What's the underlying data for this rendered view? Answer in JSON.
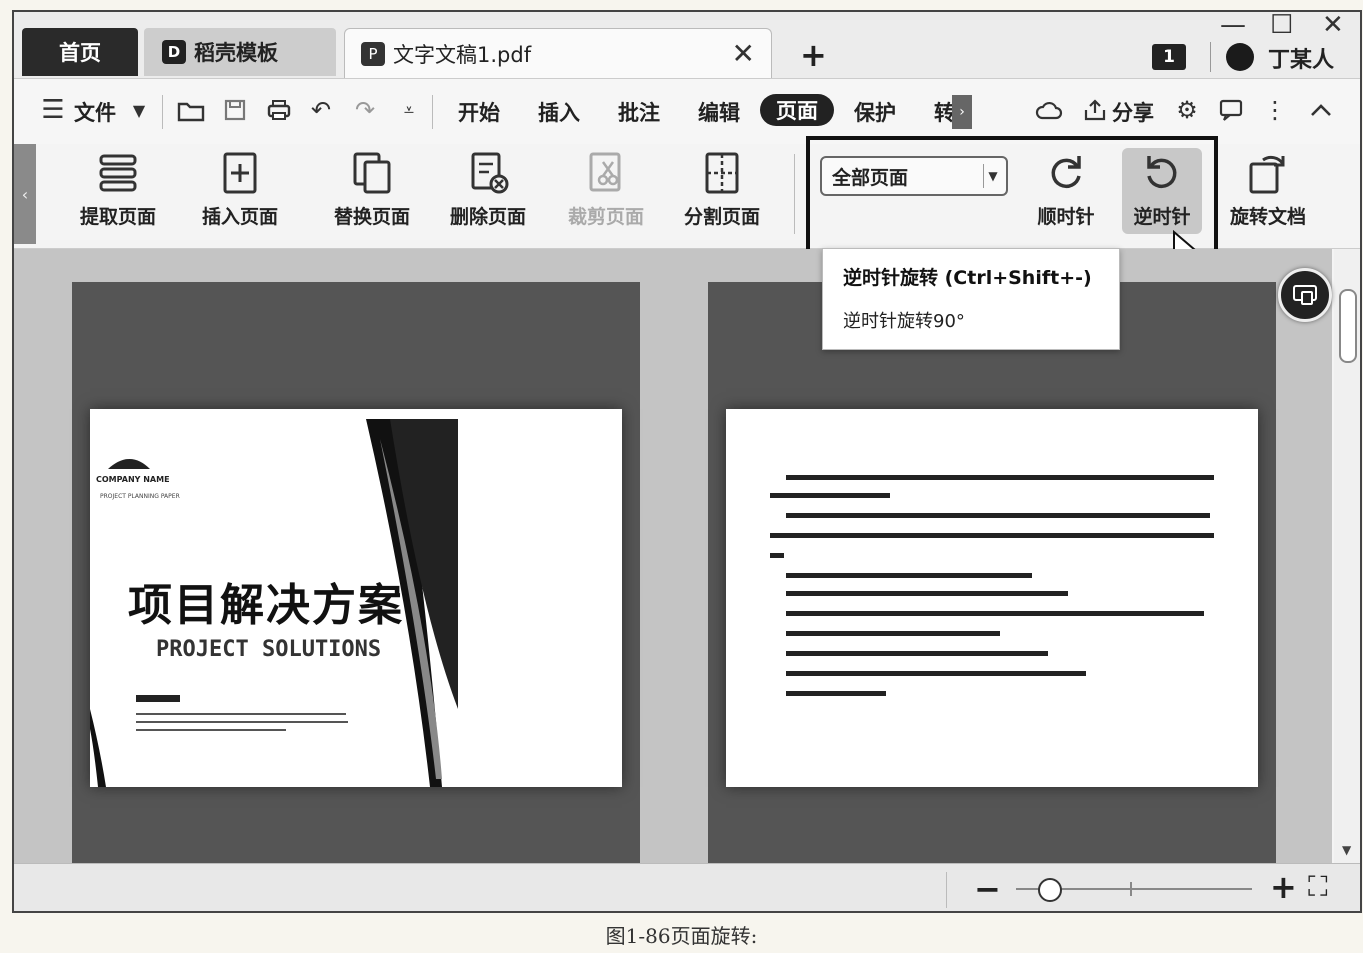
{
  "tabs": {
    "home": "首页",
    "template": "稻壳模板",
    "doc": "文字文稿1.pdf",
    "close": "✕",
    "add": "+"
  },
  "window_controls": {
    "min": "—",
    "max": "☐",
    "close": "✕"
  },
  "badge": "1",
  "user": {
    "name": "丁某人"
  },
  "menu": {
    "file": "文件",
    "items": [
      "开始",
      "插入",
      "批注",
      "编辑",
      "页面",
      "保护",
      "转"
    ],
    "share": "分享"
  },
  "ribbon": {
    "extract": "提取页面",
    "insert": "插入页面",
    "replace": "替换页面",
    "delete": "删除页面",
    "crop": "裁剪页面",
    "split": "分割页面",
    "page_range": "全部页面",
    "clockwise": "顺时针",
    "counterclockwise": "逆时针",
    "rotate_doc": "旋转文档"
  },
  "dropdown": {
    "item1": "逆时针旋转 (Ctrl+Shift+-)",
    "item2": "逆时针旋转90°"
  },
  "page1": {
    "company": "COMPANY NAME",
    "tagline": "PROJECT PLANNING PAPER",
    "title": "项目解决方案",
    "subtitle": "PROJECT SOLUTIONS"
  },
  "status": {
    "zoom_out": "−",
    "zoom_in": "+",
    "fullscreen": "⛶"
  },
  "caption": "图1-86页面旋转:",
  "colors": {
    "accent": "#222222",
    "workspace": "#c4c4c4",
    "page_bg": "#555555"
  }
}
